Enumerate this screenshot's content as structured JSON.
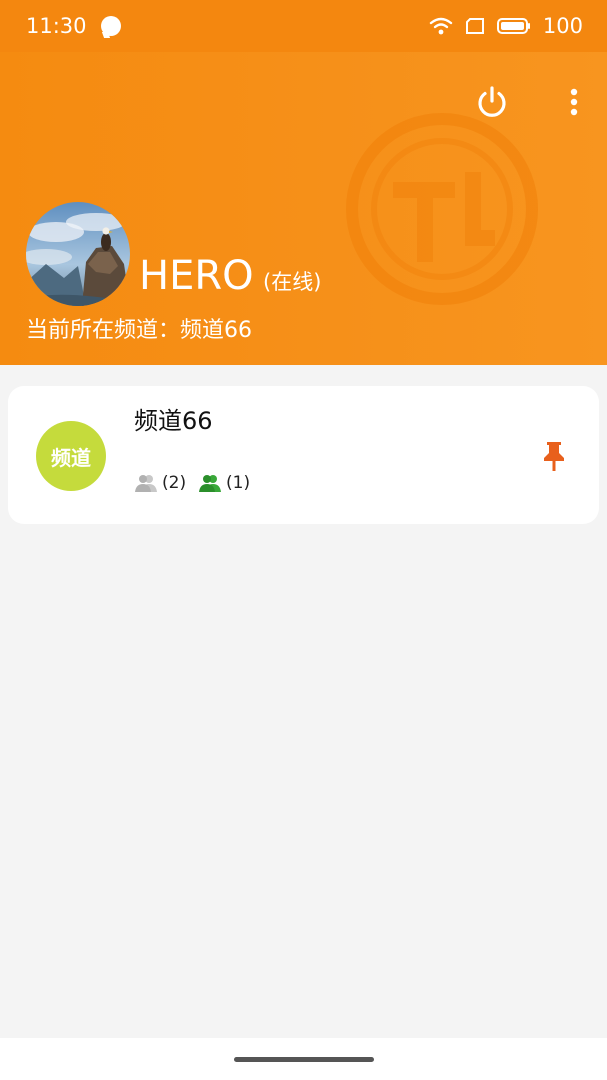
{
  "status_bar": {
    "time": "11:30",
    "battery": "100",
    "icons": [
      "chat-bubble-icon",
      "wifi-icon",
      "sim-icon",
      "battery-icon"
    ]
  },
  "header": {
    "actions": [
      "power-icon",
      "more-vertical-icon"
    ],
    "user": {
      "name": "HERO",
      "status": "(在线)",
      "current_channel": "当前所在频道：频道66"
    }
  },
  "channels": [
    {
      "badge": "频道",
      "name": "频道66",
      "members_total": "(2)",
      "members_online": "(1)",
      "pinned": true
    }
  ],
  "colors": {
    "accent": "#f58b10",
    "badge": "#c5db3c",
    "pin": "#e8601c",
    "online": "#2e9e2e",
    "offline": "#b9b9b9"
  }
}
